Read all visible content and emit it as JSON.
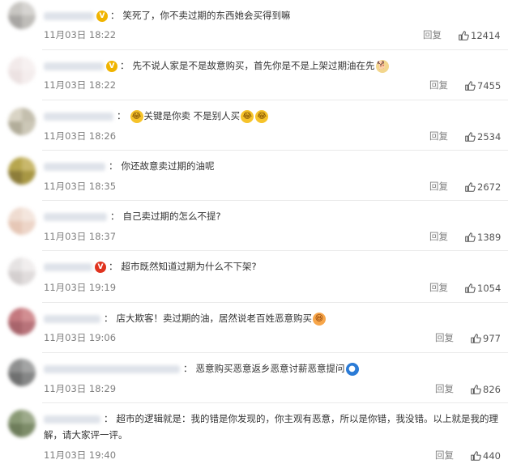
{
  "comments": [
    {
      "text": "笑死了，你不卖过期的东西她会买得到嘛",
      "time": "11月03日 18:22",
      "reply": "回复",
      "likes": "12414",
      "badge": "gold",
      "emojis_after": [],
      "emojis_before": []
    },
    {
      "text": "先不说人家是不是故意购买，首先你是不是上架过期油在先",
      "time": "11月03日 18:22",
      "reply": "回复",
      "likes": "7455",
      "badge": "gold",
      "emojis_after": [
        "doge-emoji"
      ],
      "emojis_before": []
    },
    {
      "text": "关键是你卖 不是别人买",
      "time": "11月03日 18:26",
      "reply": "回复",
      "likes": "2534",
      "badge": "",
      "emojis_after": [
        "laugh-cry-emoji",
        "laugh-cry-emoji"
      ],
      "emojis_before": [
        "laugh-cry-emoji"
      ]
    },
    {
      "text": "你还故意卖过期的油呢",
      "time": "11月03日 18:35",
      "reply": "回复",
      "likes": "2672",
      "badge": "",
      "emojis_after": [],
      "emojis_before": []
    },
    {
      "text": "自己卖过期的怎么不提?",
      "time": "11月03日 18:37",
      "reply": "回复",
      "likes": "1389",
      "badge": "",
      "emojis_after": [],
      "emojis_before": []
    },
    {
      "text": "超市既然知道过期为什么不下架?",
      "time": "11月03日 19:19",
      "reply": "回复",
      "likes": "1054",
      "badge": "red",
      "emojis_after": [],
      "emojis_before": []
    },
    {
      "text": "店大欺客！卖过期的油，居然说老百姓恶意购买",
      "time": "11月03日 19:06",
      "reply": "回复",
      "likes": "977",
      "badge": "",
      "emojis_after": [
        "big-laugh-emoji"
      ],
      "emojis_before": []
    },
    {
      "text": "恶意购买恶意返乡恶意讨薪恶意提问",
      "time": "11月03日 18:29",
      "reply": "回复",
      "likes": "826",
      "badge": "",
      "emojis_after": [
        "doraemon-emoji"
      ],
      "emojis_before": []
    },
    {
      "text": "超市的逻辑就是：我的错是你发现的，你主观有恶意，所以是你错，我没错。以上就是我的理解，请大家评一评。",
      "time": "11月03日 19:40",
      "reply": "回复",
      "likes": "440",
      "badge": "",
      "emojis_after": [],
      "emojis_before": []
    }
  ],
  "colors": {
    "meta": "#808080",
    "badge_gold": "#f0b400",
    "badge_red": "#e0331f",
    "divider": "#eaeaea"
  }
}
